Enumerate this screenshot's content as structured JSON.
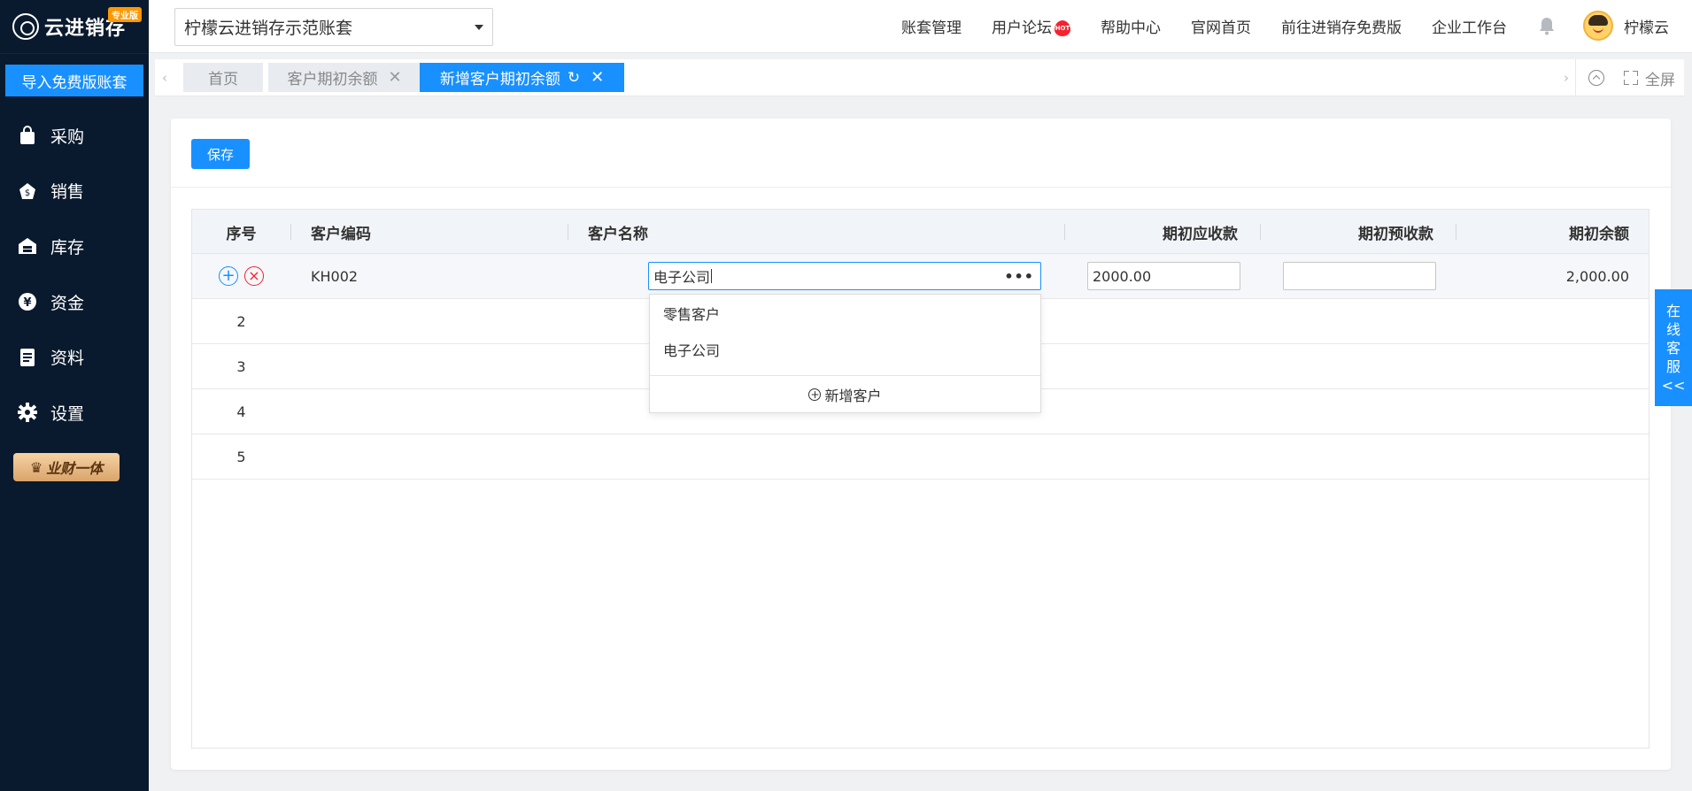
{
  "sidebar": {
    "logo_text": "云进销存",
    "logo_badge": "专业版",
    "import_button": "导入免费版账套",
    "items": [
      {
        "label": "采购",
        "icon": "bag-icon"
      },
      {
        "label": "销售",
        "icon": "money-bag-icon"
      },
      {
        "label": "库存",
        "icon": "warehouse-icon"
      },
      {
        "label": "资金",
        "icon": "yen-icon"
      },
      {
        "label": "资料",
        "icon": "document-icon"
      },
      {
        "label": "设置",
        "icon": "gear-icon"
      }
    ],
    "promo_badge": "业财一体"
  },
  "header": {
    "account_name": "柠檬云进销存示范账套",
    "nav": [
      "账套管理",
      "用户论坛",
      "帮助中心",
      "官网首页",
      "前往进销存免费版",
      "企业工作台"
    ],
    "hot_badge": "HOT",
    "user_name": "柠檬云"
  },
  "tabs": {
    "items": [
      {
        "label": "首页"
      },
      {
        "label": "客户期初余额"
      },
      {
        "label": "新增客户期初余额"
      }
    ],
    "fullscreen_label": "全屏"
  },
  "main": {
    "save_button": "保存",
    "columns": [
      "序号",
      "客户编码",
      "客户名称",
      "期初应收款",
      "期初预收款",
      "期初余额"
    ],
    "rows": [
      {
        "seq": "",
        "code": "KH002",
        "name": "电子公司",
        "receivable": "2000.00",
        "prepaid": "",
        "balance": "2,000.00"
      },
      {
        "seq": "2"
      },
      {
        "seq": "3"
      },
      {
        "seq": "4"
      },
      {
        "seq": "5"
      }
    ],
    "dropdown": {
      "options": [
        "零售客户",
        "电子公司"
      ],
      "add_label": "新增客户"
    }
  },
  "service_tab": {
    "chars": [
      "在",
      "线",
      "客",
      "服",
      "<<"
    ]
  },
  "colors": {
    "accent": "#1890ff",
    "sidebar_bg": "#0a1a2e",
    "danger": "#f5222d"
  }
}
